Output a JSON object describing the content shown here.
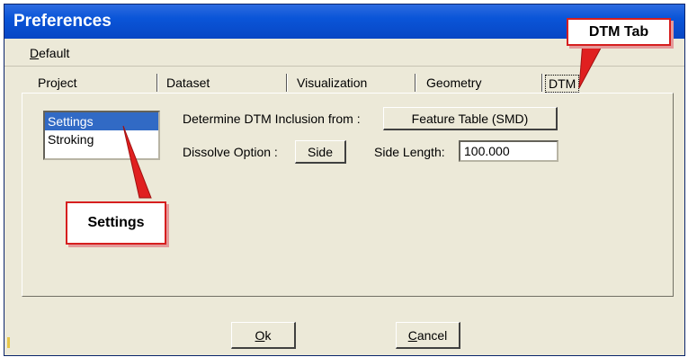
{
  "window": {
    "title": "Preferences"
  },
  "menubar": {
    "default_label": "Default",
    "default_mnemonic": "D",
    "default_rest": "efault"
  },
  "tabs": [
    {
      "label": "Project"
    },
    {
      "label": "Dataset"
    },
    {
      "label": "Visualization"
    },
    {
      "label": "Geometry"
    },
    {
      "label": "DTM",
      "active": true
    }
  ],
  "sidebar": {
    "items": [
      {
        "label": "Settings",
        "selected": true
      },
      {
        "label": "Stroking",
        "selected": false
      }
    ]
  },
  "settings": {
    "dtm_inclusion_label": "Determine DTM Inclusion from :",
    "dtm_inclusion_value": "Feature Table (SMD)",
    "dissolve_label": "Dissolve Option :",
    "dissolve_value": "Side",
    "side_length_label": "Side Length:",
    "side_length_value": "100.000"
  },
  "footer": {
    "ok_mnemonic": "O",
    "ok_rest": "k",
    "cancel_mnemonic": "C",
    "cancel_rest": "ancel"
  },
  "annotations": {
    "dtm_tab_callout": "DTM Tab",
    "settings_callout": "Settings",
    "callout_color": "#d61f1f"
  },
  "colors": {
    "titlebar": "#0a55d8",
    "dialog_bg": "#ece9d8",
    "selection": "#316ac5"
  }
}
